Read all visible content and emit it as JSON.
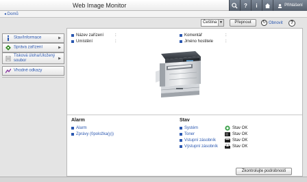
{
  "header": {
    "app_title": "Web Image Monitor",
    "login_label": "Přihlášení",
    "icons": [
      "search-icon",
      "help-icon",
      "info-icon",
      "home-icon"
    ],
    "colors": {
      "bar_start": "#7c8796",
      "bar_end": "#56606d"
    }
  },
  "breadcrumb": {
    "home_label": "◂ Domů"
  },
  "toolbar": {
    "language_value": "Čeština",
    "switch_label": "Přepnout",
    "refresh_label": "Obnovit",
    "help_glyph": "?"
  },
  "sidebar": {
    "items": [
      {
        "label": "Stav/Informace",
        "icon": "status-info-icon"
      },
      {
        "label": "Správa zařízení",
        "icon": "device-management-icon"
      },
      {
        "label": "Tisková úloha/Uložený soubor",
        "icon": "print-job-icon"
      },
      {
        "label": "Vhodné odkazy",
        "icon": "links-icon"
      }
    ]
  },
  "device_info": {
    "fields": [
      {
        "label": "Název zařízení",
        "value": ":"
      },
      {
        "label": "Umístění",
        "value": ":"
      },
      {
        "label": "Komentář",
        "value": ":"
      },
      {
        "label": "Jméno hostitele",
        "value": ":"
      }
    ]
  },
  "alarm": {
    "title": "Alarm",
    "links": [
      "Alarm",
      "Zprávy (0položka(y))"
    ]
  },
  "status": {
    "title": "Stav",
    "rows": [
      {
        "label": "Systém",
        "value": "Stav OK",
        "icon": "system-ok-icon"
      },
      {
        "label": "Toner",
        "value": "Stav OK",
        "icon": "toner-icon"
      },
      {
        "label": "Vstupní zásobník",
        "value": "Stav OK",
        "icon": "input-tray-icon"
      },
      {
        "label": "Výstupní zásobník",
        "value": "Stav OK",
        "icon": "output-tray-icon"
      }
    ],
    "check_button": "Zkontrolujte podrobnosti"
  }
}
